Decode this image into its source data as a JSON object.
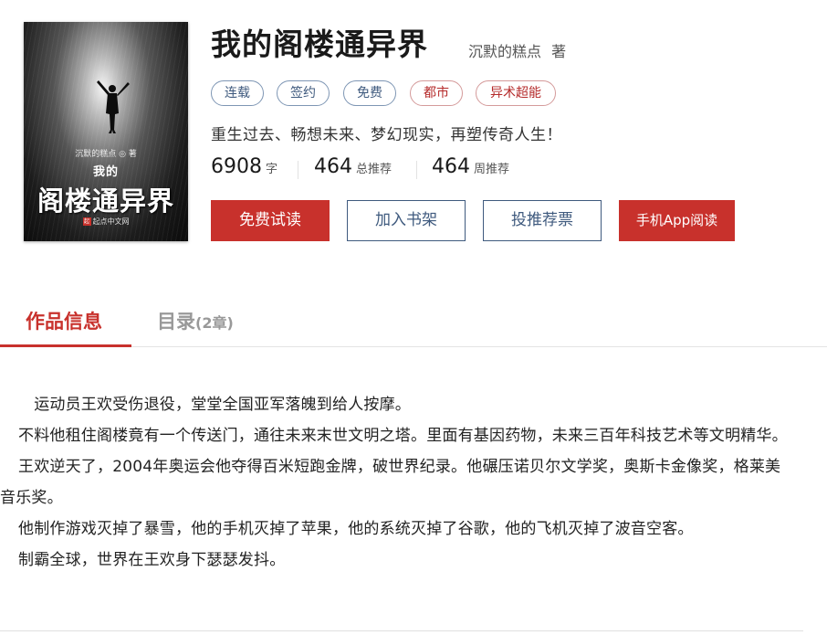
{
  "book": {
    "title": "我的阁楼通异界",
    "author": "沉默的糕点",
    "author_suffix": "著",
    "cover": {
      "author_line": "沉默的糕点 ◎ 著",
      "title_small": "我的",
      "title_big": "阁楼通异界",
      "publisher": "起点中文网"
    },
    "tags": [
      {
        "label": "连载",
        "style": "blue"
      },
      {
        "label": "签约",
        "style": "blue"
      },
      {
        "label": "免费",
        "style": "blue"
      },
      {
        "label": "都市",
        "style": "red"
      },
      {
        "label": "异术超能",
        "style": "red"
      }
    ],
    "intro": "重生过去、畅想未来、梦幻现实，再塑传奇人生！",
    "stats": [
      {
        "value": "6908",
        "unit": "字"
      },
      {
        "value": "464",
        "unit": "总推荐"
      },
      {
        "value": "464",
        "unit": "周推荐"
      }
    ],
    "buttons": {
      "free_read": "免费试读",
      "add_shelf": "加入书架",
      "vote": "投推荐票",
      "app_read": "手机App阅读"
    }
  },
  "tabs": {
    "info": "作品信息",
    "catalog": "目录",
    "catalog_count": "(2章)"
  },
  "description": [
    "　运动员王欢受伤退役，堂堂全国亚军落魄到给人按摩。",
    "不料他租住阁楼竟有一个传送门，通往未来末世文明之塔。里面有基因药物，未来三百年科技艺术等文明精华。",
    "王欢逆天了，2004年奥运会他夺得百米短跑金牌，破世界纪录。他碾压诺贝尔文学奖，奥斯卡金像奖，格莱美音乐奖。",
    "他制作游戏灭掉了暴雪，他的手机灭掉了苹果，他的系统灭掉了谷歌，他的飞机灭掉了波音空客。",
    "制霸全球，世界在王欢身下瑟瑟发抖。"
  ],
  "colors": {
    "accent": "#c8312c",
    "outline_blue": "#3f5a7e"
  }
}
